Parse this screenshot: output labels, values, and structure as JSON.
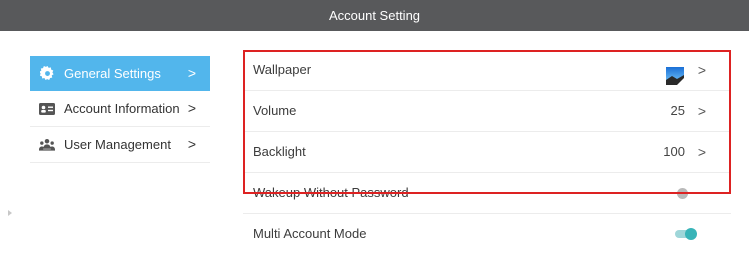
{
  "window": {
    "title": "Account Setting"
  },
  "sidebar": {
    "items": [
      {
        "label": "General Settings",
        "icon": "gear-icon",
        "active": true
      },
      {
        "label": "Account Information",
        "icon": "id-card-icon",
        "active": false
      },
      {
        "label": "User Management",
        "icon": "users-icon",
        "active": false
      }
    ],
    "chevron": ">"
  },
  "settings": {
    "wallpaper": {
      "label": "Wallpaper",
      "icon": "wallpaper-thumbnail-icon"
    },
    "volume": {
      "label": "Volume",
      "value": "25"
    },
    "backlight": {
      "label": "Backlight",
      "value": "100"
    },
    "wakeup": {
      "label": "Wakeup Without Password",
      "enabled": false
    },
    "multi_account": {
      "label": "Multi Account Mode",
      "enabled": true
    },
    "chevron": ">"
  },
  "colors": {
    "titlebar": "#58595b",
    "sidebar_active": "#52b6ec",
    "toggle_on": "#38b4b8",
    "toggle_off": "#b9b9b9",
    "highlight": "#dd2222"
  }
}
